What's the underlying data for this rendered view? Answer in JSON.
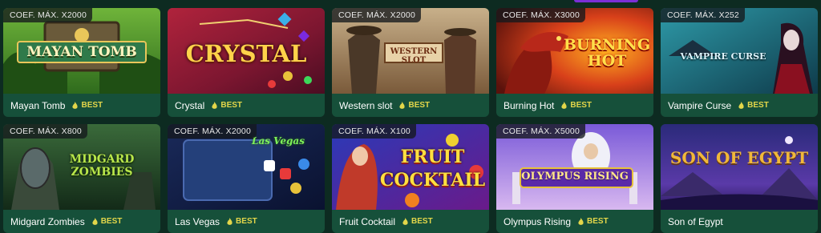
{
  "colors": {
    "page_bg": "#0d2b21",
    "card_footer": "#16503a",
    "best": "#e3d64a"
  },
  "games": [
    {
      "title": "Mayan Tomb",
      "coef": "COEF. MÁX. X2000",
      "badge": "BEST",
      "logo": "MAYAN TOMB"
    },
    {
      "title": "Crystal",
      "coef": "",
      "badge": "BEST",
      "logo": "CRYSTAL"
    },
    {
      "title": "Western slot",
      "coef": "COEF. MÁX. X2000",
      "badge": "BEST",
      "logo": "WESTERN SLOT"
    },
    {
      "title": "Burning Hot",
      "coef": "COEF. MÁX. X3000",
      "badge": "BEST",
      "logo": "BURNING HOT"
    },
    {
      "title": "Vampire Curse",
      "coef": "COEF. MÁX. X252",
      "badge": "BEST",
      "logo": "VAMPIRE CURSE"
    },
    {
      "title": "Midgard Zombies",
      "coef": "COEF. MÁX. X800",
      "badge": "BEST",
      "logo": "MIDGARD ZOMBIES"
    },
    {
      "title": "Las Vegas",
      "coef": "COEF. MÁX. X2000",
      "badge": "BEST",
      "logo": "Las Vegas"
    },
    {
      "title": "Fruit Cocktail",
      "coef": "COEF. MÁX. X100",
      "badge": "BEST",
      "logo": "FRUIT COCKTAIL"
    },
    {
      "title": "Olympus Rising",
      "coef": "COEF. MÁX. X5000",
      "badge": "BEST",
      "logo": "OLYMPUS RISING"
    },
    {
      "title": "Son of Egypt",
      "coef": "",
      "badge": "",
      "logo": "SON OF EGYPT"
    }
  ]
}
